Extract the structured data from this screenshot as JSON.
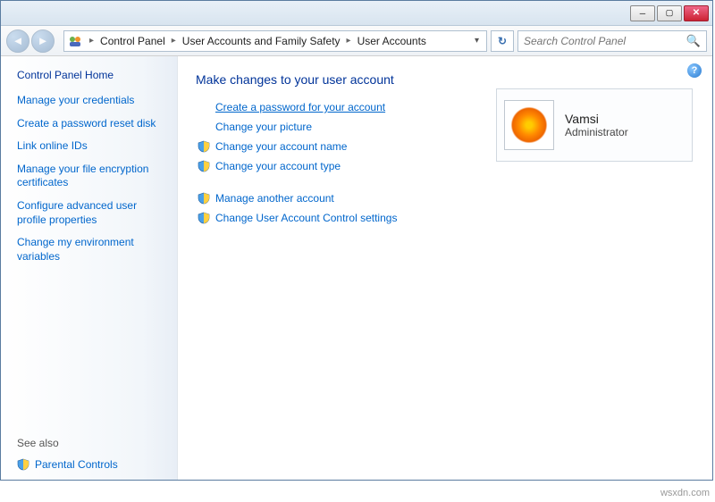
{
  "breadcrumb": {
    "items": [
      "Control Panel",
      "User Accounts and Family Safety",
      "User Accounts"
    ]
  },
  "search": {
    "placeholder": "Search Control Panel"
  },
  "sidebar": {
    "title": "Control Panel Home",
    "links": [
      "Manage your credentials",
      "Create a password reset disk",
      "Link online IDs",
      "Manage your file encryption certificates",
      "Configure advanced user profile properties",
      "Change my environment variables"
    ],
    "see_also_label": "See also",
    "see_also_items": [
      "Parental Controls"
    ]
  },
  "main": {
    "title": "Make changes to your user account",
    "tasks_top": [
      {
        "label": "Create a password for your account",
        "shield": false,
        "highlight": true
      },
      {
        "label": "Change your picture",
        "shield": false,
        "highlight": false
      },
      {
        "label": "Change your account name",
        "shield": true,
        "highlight": false
      },
      {
        "label": "Change your account type",
        "shield": true,
        "highlight": false
      }
    ],
    "tasks_bottom": [
      {
        "label": "Manage another account",
        "shield": true
      },
      {
        "label": "Change User Account Control settings",
        "shield": true
      }
    ]
  },
  "account": {
    "name": "Vamsi",
    "role": "Administrator"
  },
  "watermark": "wsxdn.com"
}
